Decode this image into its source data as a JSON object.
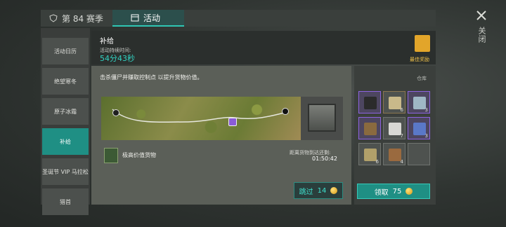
{
  "tabs": {
    "season": "第 84 赛季",
    "activity": "活动"
  },
  "close": {
    "label": "关闭"
  },
  "sidebar": {
    "items": [
      {
        "label": "活动日历"
      },
      {
        "label": "绝望寒冬"
      },
      {
        "label": "原子冰霜"
      },
      {
        "label": "补给",
        "active": true
      },
      {
        "label": "圣诞节 VIP 马拉松"
      },
      {
        "label": "猎首"
      }
    ]
  },
  "header": {
    "title": "补给",
    "duration_label": "活动持续时间:",
    "duration_value": "54分43秒",
    "reward_label": "最佳奖励"
  },
  "main": {
    "description": "击杀僵尸并赚取控制点 以提升货物价值。",
    "goods_label": "极高价值货物",
    "eta_label": "距离货物到达还剩:",
    "eta_value": "01:50:42",
    "skip_label": "跳过",
    "skip_cost": "14"
  },
  "store": {
    "label": "仓库",
    "slots": [
      {
        "count": "",
        "color": "#2b2b2b",
        "icon": "backpack-icon"
      },
      {
        "count": "6",
        "color": "#c9b98a",
        "icon": "bandage-icon"
      },
      {
        "count": "3",
        "color": "#9fb7c5",
        "icon": "glass-icon"
      },
      {
        "count": "",
        "color": "#8a6a3f",
        "icon": "rifle-icon"
      },
      {
        "count": "7",
        "color": "#d8d8d4",
        "icon": "paper-icon"
      },
      {
        "count": "3",
        "color": "#5a78c8",
        "icon": "blue-item-icon"
      },
      {
        "count": "6",
        "color": "#b1a06a",
        "icon": "cloth-icon"
      },
      {
        "count": "4",
        "color": "#9a6a3f",
        "icon": "leather-icon"
      },
      {
        "count": "",
        "color": "",
        "icon": "empty-slot"
      }
    ],
    "claim_label": "领取",
    "claim_cost": "75"
  }
}
